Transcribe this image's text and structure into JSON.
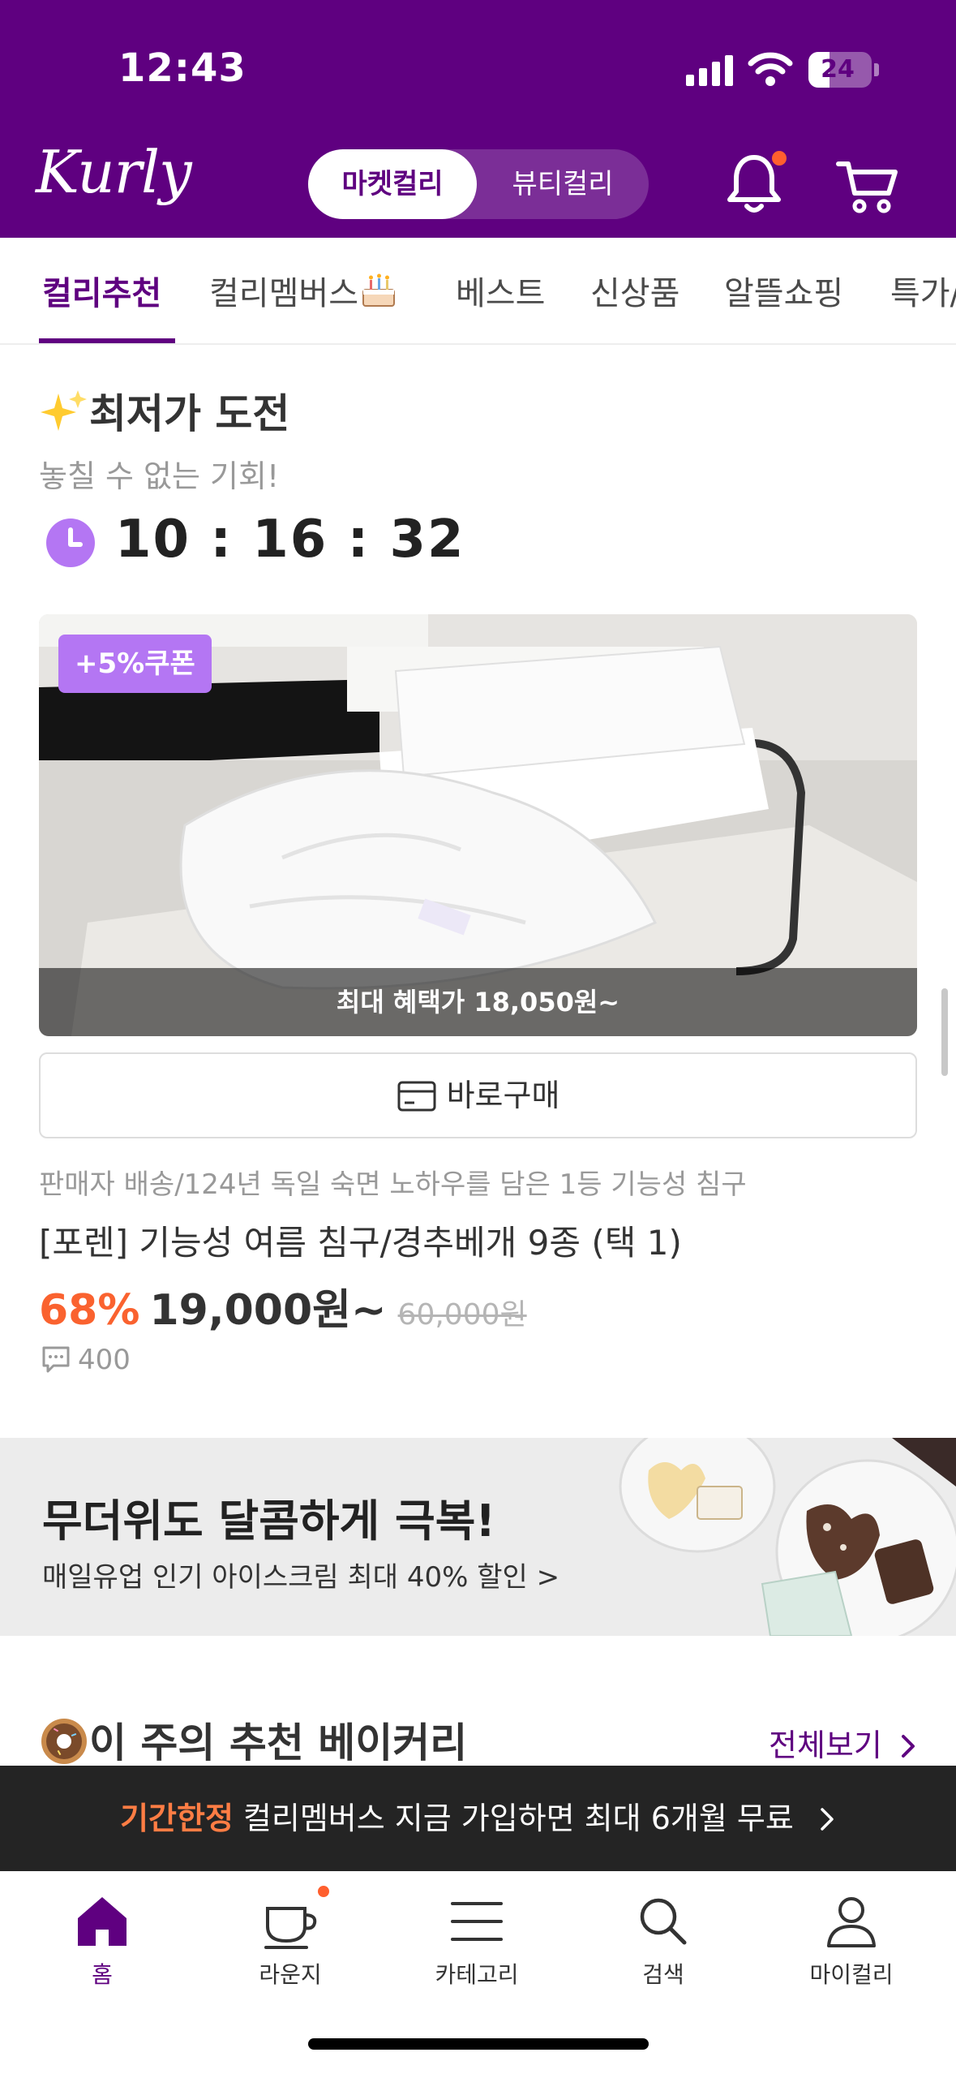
{
  "status_bar": {
    "time": "12:43",
    "battery": "24"
  },
  "header": {
    "logo": "Kurly",
    "segments": {
      "active": "마켓컬리",
      "inactive": "뷰티컬리"
    }
  },
  "tabs": [
    {
      "label": "컬리추천",
      "active": true
    },
    {
      "label": "컬리멤버스",
      "active": false
    },
    {
      "label": "베스트",
      "active": false
    },
    {
      "label": "신상품",
      "active": false
    },
    {
      "label": "알뜰쇼핑",
      "active": false
    },
    {
      "label": "특가/",
      "active": false
    }
  ],
  "deal_section": {
    "title": "최저가 도전",
    "subtitle": "놓칠 수 없는 기회!",
    "timer": "10 : 16 : 32",
    "coupon_badge": "+5%쿠폰",
    "benefit_text": "최대 혜택가 18,050원~",
    "buy_button": "바로구매",
    "seller_note": "판매자 배송/124년 독일 숙면 노하우를 담은 1등 기능성 침구",
    "product_name": "[포렌] 기능성 여름 침구/경추베개 9종 (택 1)",
    "discount_rate": "68%",
    "price": "19,000원~",
    "original_price": "60,000원",
    "review_count": "400"
  },
  "banner": {
    "title": "무더위도 달콤하게 극복!",
    "subtitle": "매일유업 인기 아이스크림 최대 40% 할인 >"
  },
  "bakery_section": {
    "title": "이 주의 추천 베이커리",
    "see_all": "전체보기"
  },
  "promo_bar": {
    "highlight": "기간한정",
    "text": "컬리멤버스 지금 가입하면 최대 6개월 무료"
  },
  "bottom_nav": [
    {
      "label": "홈",
      "icon": "home-icon",
      "active": true
    },
    {
      "label": "라운지",
      "icon": "cup-icon",
      "active": false
    },
    {
      "label": "카테고리",
      "icon": "menu-icon",
      "active": false
    },
    {
      "label": "검색",
      "icon": "search-icon",
      "active": false
    },
    {
      "label": "마이컬리",
      "icon": "user-icon",
      "active": false
    }
  ],
  "colors": {
    "brand": "#5f0080",
    "coupon": "#b476f3",
    "discount": "#fa622f",
    "promo_highlight": "#ff7d44"
  }
}
